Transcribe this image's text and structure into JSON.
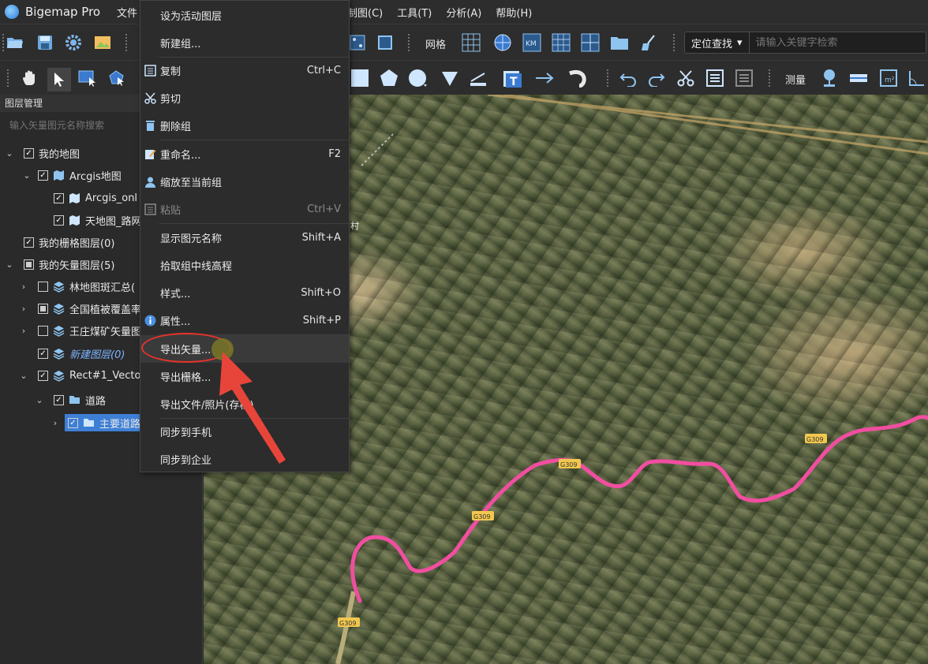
{
  "app": {
    "title": "Bigemap Pro"
  },
  "menubar": {
    "file": "文件",
    "draw": "制图(C)",
    "tools": "工具(T)",
    "analysis": "分析(A)",
    "help": "帮助(H)"
  },
  "toolbar": {
    "grid_label": "网格",
    "measure_label": "测量",
    "search_type": "定位查找",
    "search_placeholder": "请输入关键字检索"
  },
  "layer_panel": {
    "title": "图层管理",
    "search_placeholder": "输入矢量图元名称搜索",
    "tree": [
      {
        "label": "我的地图"
      },
      {
        "label": "Arcgis地图"
      },
      {
        "label": "Arcgis_onl"
      },
      {
        "label": "天地图_路网"
      },
      {
        "label": "我的栅格图层(0)"
      },
      {
        "label": "我的矢量图层(5)"
      },
      {
        "label": "林地图斑汇总("
      },
      {
        "label": "全国植被覆盖率"
      },
      {
        "label": "王庄煤矿矢量图"
      },
      {
        "label": "新建图层(0)"
      },
      {
        "label": "Rect#1_Vecto"
      },
      {
        "label": "道路"
      },
      {
        "label": "主要道路"
      }
    ]
  },
  "context_menu": {
    "items": [
      {
        "label": "设为活动图层",
        "shortcut": ""
      },
      {
        "label": "新建组...",
        "shortcut": ""
      },
      {
        "label": "复制",
        "shortcut": "Ctrl+C"
      },
      {
        "label": "剪切",
        "shortcut": ""
      },
      {
        "label": "删除组",
        "shortcut": ""
      },
      {
        "label": "重命名...",
        "shortcut": "F2"
      },
      {
        "label": "缩放至当前组",
        "shortcut": ""
      },
      {
        "label": "粘贴",
        "shortcut": "Ctrl+V"
      },
      {
        "label": "显示图元名称",
        "shortcut": "Shift+A"
      },
      {
        "label": "拾取组中线高程",
        "shortcut": ""
      },
      {
        "label": "样式...",
        "shortcut": "Shift+O"
      },
      {
        "label": "属性...",
        "shortcut": "Shift+P"
      },
      {
        "label": "导出矢量...",
        "shortcut": ""
      },
      {
        "label": "导出栅格...",
        "shortcut": ""
      },
      {
        "label": "导出文件/照片(存档)",
        "shortcut": ""
      },
      {
        "label": "同步到手机",
        "shortcut": ""
      },
      {
        "label": "同步到企业",
        "shortcut": ""
      }
    ]
  },
  "map": {
    "road_labels": [
      "G309",
      "G309",
      "G309",
      "G309"
    ],
    "village_label": "村"
  },
  "colors": {
    "road": "#f04ea0",
    "accent": "#3e7fd6",
    "annotation": "#e8332a"
  }
}
